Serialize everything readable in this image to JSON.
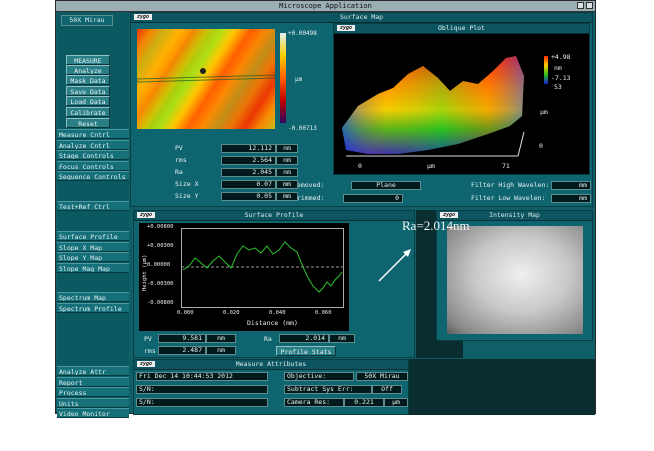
{
  "window": {
    "title": "Microscope Application"
  },
  "sidebar": {
    "objective": "50X Mirau",
    "buttons": [
      "MEASURE",
      "Analyze",
      "Mask Data",
      "Save Data",
      "Load Data",
      "Calibrate",
      "Reset"
    ],
    "menu1": [
      "Measure Cntrl",
      "Analyze Cntrl",
      "Stage Controls",
      "Focus Controls",
      "Sequence Controls"
    ],
    "menu2": [
      "Test+Ref Ctrl"
    ],
    "menu3": [
      "Surface Profile",
      "Slope X Map",
      "Slope Y Map",
      "Slope Mag Map"
    ],
    "menu4": [
      "Spectrum Map",
      "Spectrum Profile"
    ],
    "menu5": [
      "Analyze Attr",
      "Report",
      "Process",
      "Units",
      "Video Monitor"
    ]
  },
  "surface_map": {
    "title": "Surface Map",
    "logo": "zygo",
    "scale_max": "+0.00498",
    "scale_unit": "µm",
    "scale_min": "-0.00713",
    "stats": [
      {
        "label": "PV",
        "value": "12.112",
        "unit": "nm"
      },
      {
        "label": "rms",
        "value": "2.564",
        "unit": "nm"
      },
      {
        "label": "Ra",
        "value": "2.045",
        "unit": "nm"
      },
      {
        "label": "Size X",
        "value": "0.07",
        "unit": "mm"
      },
      {
        "label": "Size Y",
        "value": "0.05",
        "unit": "mm"
      }
    ],
    "removed_label": "Removed:",
    "removed_value": "Plane",
    "trimmed_label": "Trimmed:",
    "trimmed_value": "0",
    "filter_high_label": "Filter High Wavelen:",
    "filter_high_unit": "mm",
    "filter_low_label": "Filter Low Wavelen:",
    "filter_low_unit": "mm"
  },
  "oblique_plot": {
    "title": "Oblique Plot",
    "logo": "zygo",
    "z_max": "+4.98",
    "z_unit": "nm",
    "z_min": "-7.13",
    "z_extra": "53",
    "y_label": "µm",
    "y_zero": "0",
    "x_zero": "0",
    "x_label": "µm",
    "x_max": "71"
  },
  "surface_profile": {
    "title": "Surface Profile",
    "logo": "zygo",
    "y_ticks": [
      "+0.00800",
      "+0.00300",
      "0.00000",
      "-0.00300",
      "-0.00800"
    ],
    "y_label": "Height (µm)",
    "x_ticks": [
      "0.000",
      "0.020",
      "0.040",
      "0.060"
    ],
    "x_label": "Distance (mm)",
    "pv_label": "PV",
    "pv_value": "9.581",
    "pv_unit": "nm",
    "rms_label": "rms",
    "rms_value": "2.487",
    "rms_unit": "nm",
    "ra_label": "Ra",
    "ra_value": "2.014",
    "ra_unit": "nm",
    "stats_button": "Profile Stats"
  },
  "intensity_map": {
    "title": "Intensity Map",
    "logo": "zygo"
  },
  "measure_attrs": {
    "title": "Measure Attributes",
    "logo": "zygo",
    "date": "Fri Dec 14 10:44:53 2012",
    "sn1": "S/N:",
    "sn2": "S/N:",
    "objective_label": "Objective:",
    "objective_value": "50X Mirau",
    "subtract_label": "Subtract Sys Err:",
    "subtract_value": "Off",
    "camera_label": "Camera Res:",
    "camera_value": "0.221",
    "camera_unit": "µm"
  },
  "annotation": {
    "text": "Ra=2.014nm"
  },
  "colors": {
    "panel": "#0e6570",
    "background": "#0e5f66",
    "annotation": "#ffffff"
  }
}
